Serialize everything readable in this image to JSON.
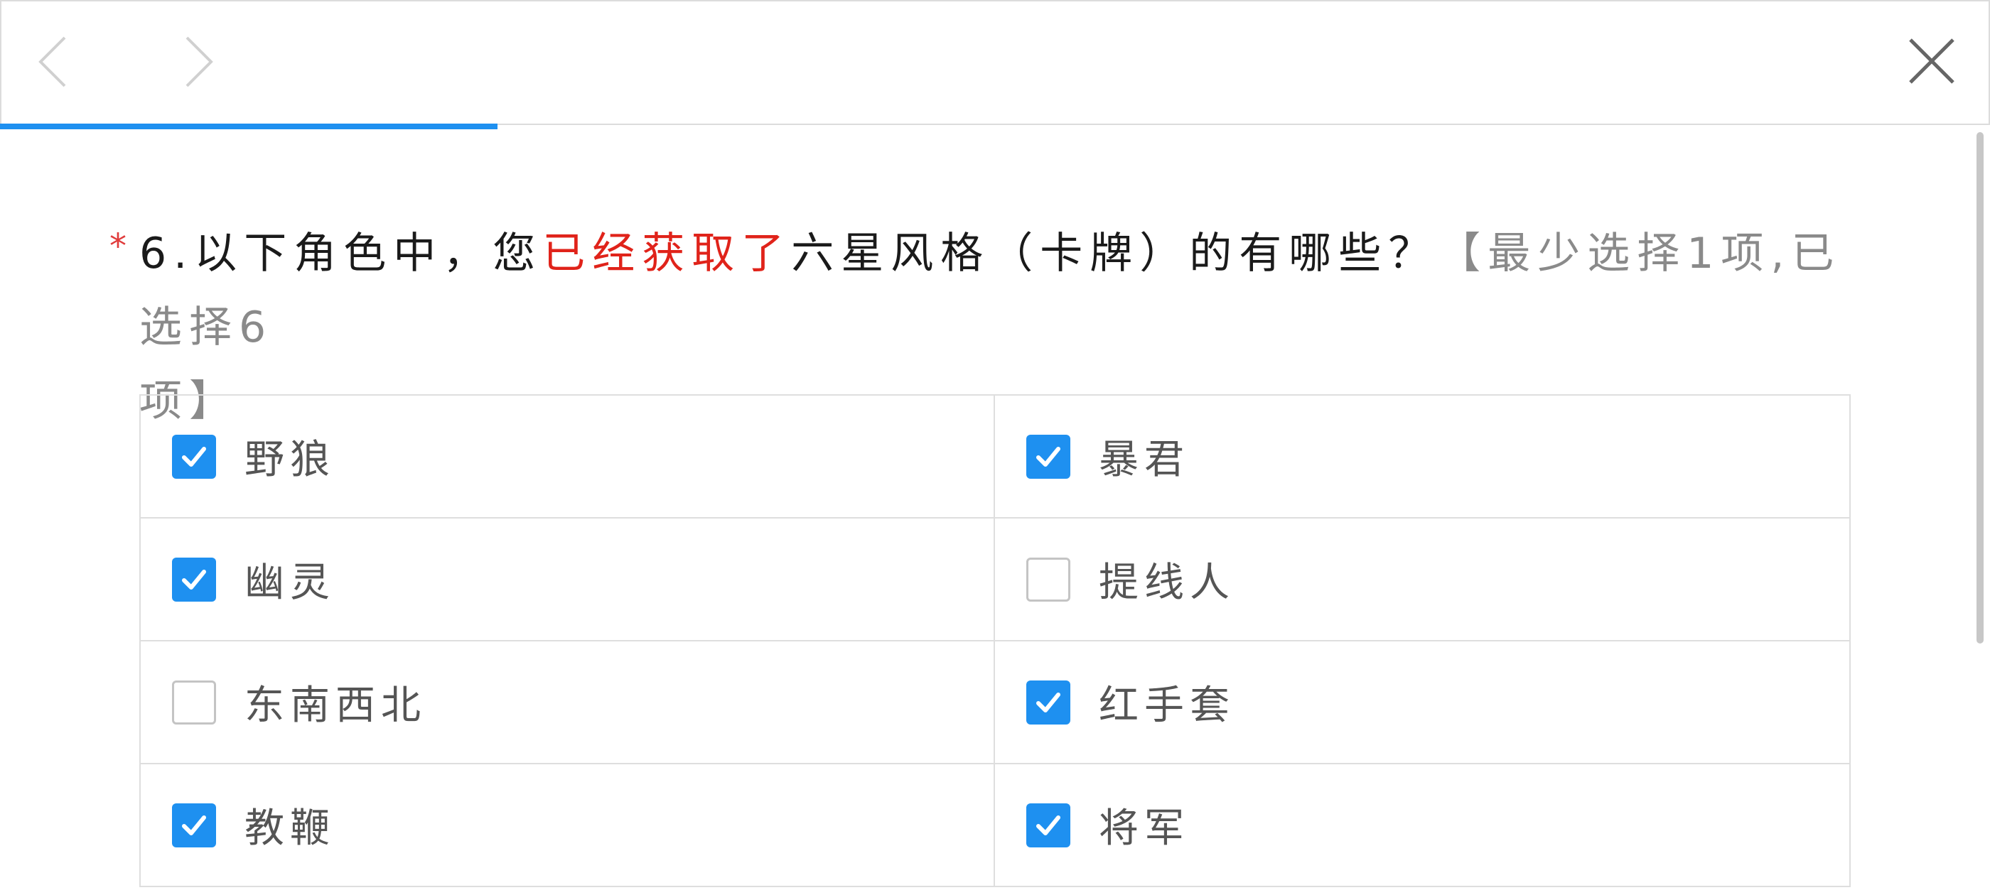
{
  "question": {
    "required_mark": "*",
    "number": "6.",
    "text_before": "以下角色中，您",
    "highlight": "已经获取了",
    "text_after": "六星风格（卡牌）的有哪些？",
    "hint_line1": "【最少选择1项,已选择6",
    "hint_line2": "项】"
  },
  "progress": {
    "fraction": 0.25,
    "color": "#1e90f0"
  },
  "colors": {
    "accent": "#1e90f0",
    "required": "#e03c3c",
    "highlight": "#e0231a"
  },
  "options": [
    {
      "label": "野狼",
      "checked": true
    },
    {
      "label": "暴君",
      "checked": true
    },
    {
      "label": "幽灵",
      "checked": true
    },
    {
      "label": "提线人",
      "checked": false
    },
    {
      "label": "东南西北",
      "checked": false
    },
    {
      "label": "红手套",
      "checked": true
    },
    {
      "label": "教鞭",
      "checked": true
    },
    {
      "label": "将军",
      "checked": true
    }
  ],
  "icons": [
    "chevron-left-icon",
    "chevron-right-icon",
    "close-icon",
    "checkmark-icon"
  ]
}
